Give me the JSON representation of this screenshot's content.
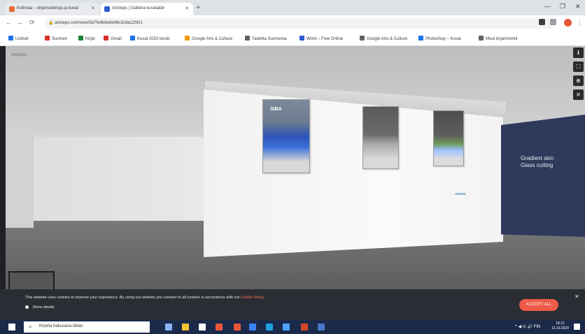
{
  "browser": {
    "tabs": [
      {
        "label": "Kotimaa – ohjelmatietoja ja kuvat",
        "favicon_color": "#e86a33"
      },
      {
        "label": "Artsteps | Galleria kuvataide",
        "favicon_color": "#2b5cc9"
      }
    ],
    "new_tab_label": "+",
    "window_controls": {
      "minimize": "—",
      "maximize": "❐",
      "close": "✕"
    },
    "address": "artsteps.com/view/5d7fe8b6e8d48c3c9a12f301",
    "nav": {
      "back": "←",
      "forward": "→",
      "reload": "⟳"
    },
    "bookmarks": [
      {
        "label": "Uutiset",
        "color": "#1a73e8"
      },
      {
        "label": "Suomen",
        "color": "#d93025"
      },
      {
        "label": "Kirjat",
        "color": "#188038"
      },
      {
        "label": "Gmail",
        "color": "#d93025"
      },
      {
        "label": "Kuvat 2020 kevät",
        "color": "#1a73e8"
      },
      {
        "label": "Google Arts & Culture",
        "color": "#f29900"
      },
      {
        "label": "Taidetta Suomesta",
        "color": "#5f6368"
      },
      {
        "label": "Word – Free Online",
        "color": "#2b5cc9"
      },
      {
        "label": "Google Arts & Culture",
        "color": "#5f6368"
      },
      {
        "label": "Photoshop – Kuvat",
        "color": "#1a73e8"
      },
      {
        "label": "Muut kirjanmerkit",
        "color": "#5f6368"
      }
    ]
  },
  "gallery": {
    "loading_label": "Artsteps",
    "paintings": [
      {
        "title": "SIBA",
        "color": "#2e55b8"
      },
      {
        "title": "",
        "color": "#a9a9a9"
      },
      {
        "title": "",
        "color": "#6e9a5a"
      }
    ],
    "wall_text": [
      "Gradient skin",
      "Glass cutting"
    ],
    "tools": [
      "ℹ",
      "⛶",
      "⊕",
      "✕"
    ]
  },
  "cookie": {
    "text": "This website uses cookies to improve your experience. By using our website you consent to all cookies in accordance with our",
    "link": "Cookie Policy.",
    "details": "Show details",
    "accept": "ACCEPT ALL",
    "close": "✕"
  },
  "taskbar": {
    "search_placeholder": "Kirjoita hakusana tähän",
    "tray": "^ ◀ ⊙ 🔊 FIN",
    "time": "18.12",
    "date": "12.10.2020",
    "icons": [
      {
        "name": "task-view-icon",
        "color": "#8ab4f8"
      },
      {
        "name": "file-explorer-icon",
        "color": "#f2c12e"
      },
      {
        "name": "store-icon",
        "color": "#ffffff"
      },
      {
        "name": "office-icon",
        "color": "#e8573a"
      },
      {
        "name": "chrome-icon",
        "color": "#e8573a"
      },
      {
        "name": "mail-icon",
        "color": "#3b82f6"
      },
      {
        "name": "edge-icon",
        "color": "#1fa3e0"
      },
      {
        "name": "photos-icon",
        "color": "#4da3ff"
      },
      {
        "name": "powerpoint-icon",
        "color": "#d24726"
      },
      {
        "name": "word-icon",
        "color": "#4a78c9"
      }
    ]
  }
}
